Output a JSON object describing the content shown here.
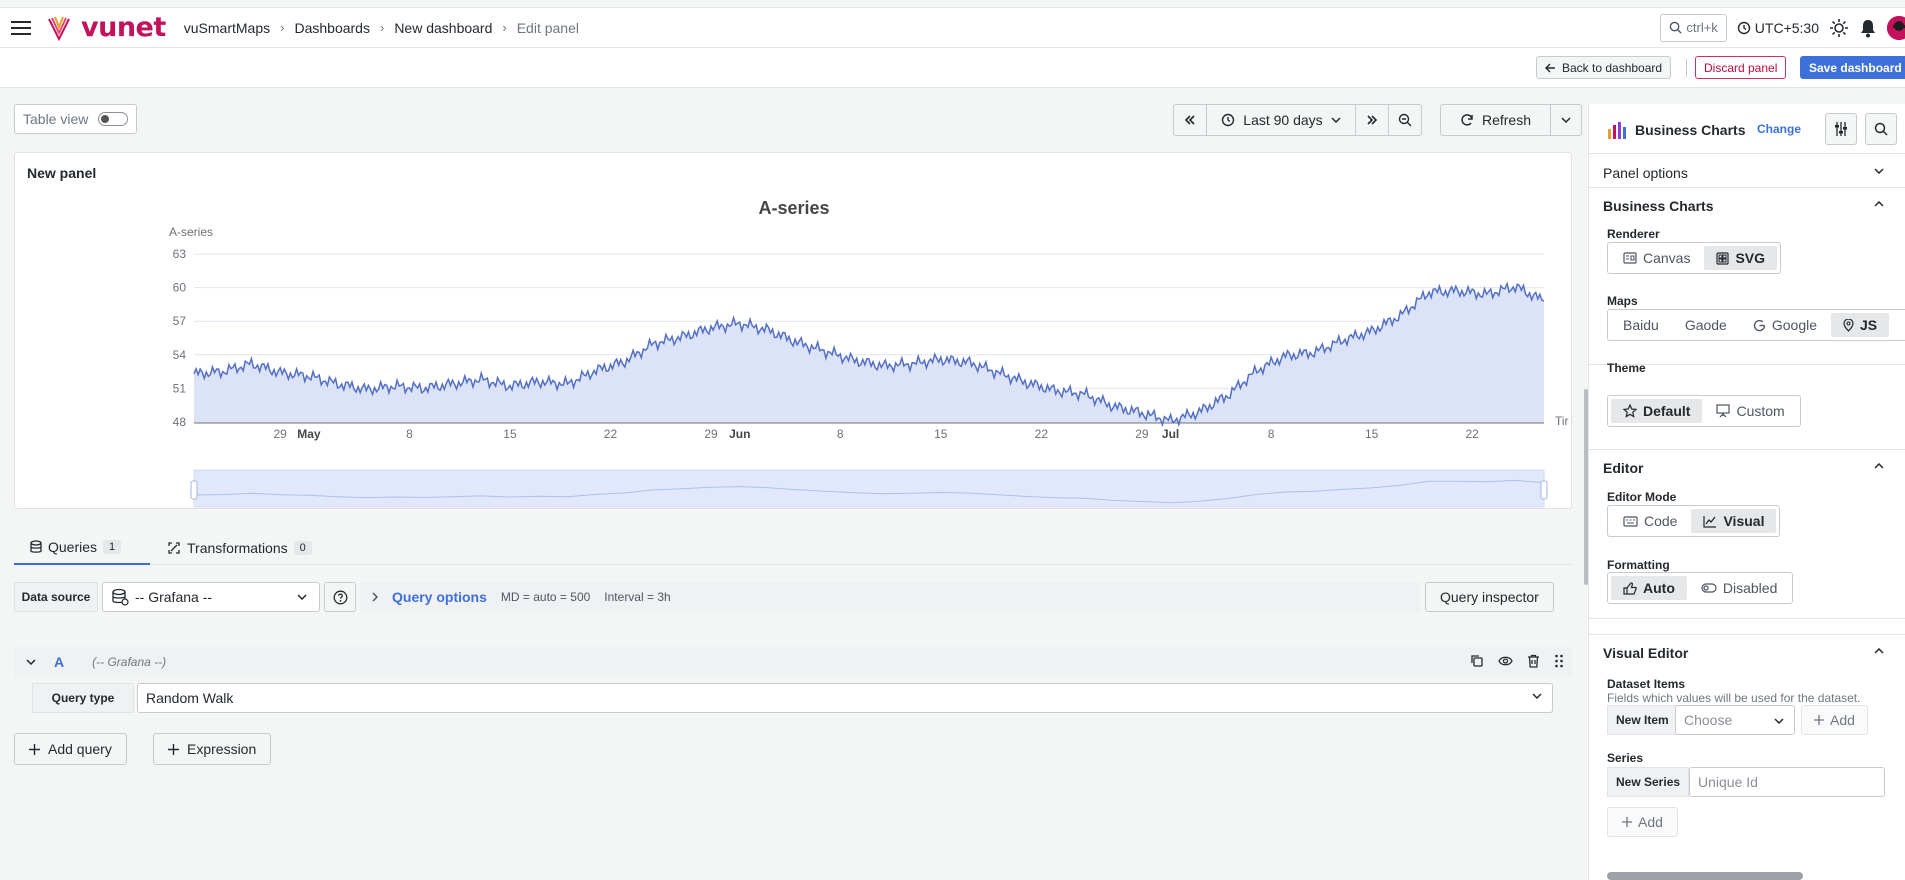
{
  "app": {
    "logo": "vunet"
  },
  "breadcrumbs": [
    "vuSmartMaps",
    "Dashboards",
    "New dashboard",
    "Edit panel"
  ],
  "topbar": {
    "search_label": "ctrl+k",
    "timezone": "UTC+5:30"
  },
  "actions": {
    "back": "Back to dashboard",
    "discard": "Discard panel",
    "save": "Save dashboard"
  },
  "toolbar": {
    "table_view": "Table view",
    "time_range": "Last 90 days",
    "refresh": "Refresh"
  },
  "panel": {
    "title": "New panel"
  },
  "chart_data": {
    "type": "area",
    "title": "A-series",
    "ylabel": "A-series",
    "xlabel": "Tir",
    "ylim": [
      48,
      63
    ],
    "yticks": [
      48,
      51,
      54,
      57,
      60,
      63
    ],
    "xlim": [
      0,
      94
    ],
    "xticks": [
      {
        "x": 6,
        "label": "29"
      },
      {
        "x": 8,
        "label": "May",
        "bold": true
      },
      {
        "x": 15,
        "label": "8"
      },
      {
        "x": 22,
        "label": "15"
      },
      {
        "x": 29,
        "label": "22"
      },
      {
        "x": 36,
        "label": "29"
      },
      {
        "x": 38,
        "label": "Jun",
        "bold": true
      },
      {
        "x": 45,
        "label": "8"
      },
      {
        "x": 52,
        "label": "15"
      },
      {
        "x": 59,
        "label": "22"
      },
      {
        "x": 66,
        "label": "29"
      },
      {
        "x": 68,
        "label": "Jul",
        "bold": true
      },
      {
        "x": 75,
        "label": "8"
      },
      {
        "x": 82,
        "label": "15"
      },
      {
        "x": 89,
        "label": "22"
      }
    ],
    "series": [
      {
        "x": [
          0,
          2,
          4,
          6,
          8,
          10,
          12,
          14,
          16,
          18,
          20,
          22,
          24,
          26,
          28,
          30,
          32,
          34,
          36,
          38,
          40,
          42,
          44,
          46,
          48,
          50,
          52,
          54,
          56,
          58,
          60,
          62,
          64,
          66,
          68,
          70,
          72,
          74,
          76,
          78,
          80,
          82,
          84,
          86,
          88,
          90,
          92,
          94
        ],
        "values": [
          52.3,
          52.5,
          53.2,
          52.4,
          52.1,
          51.4,
          50.9,
          51.2,
          51.0,
          51.4,
          51.8,
          51.2,
          51.6,
          51.4,
          52.6,
          53.4,
          55.0,
          55.6,
          56.4,
          56.8,
          56.2,
          55.1,
          54.3,
          53.5,
          53.0,
          53.2,
          53.6,
          53.3,
          52.4,
          51.5,
          50.8,
          50.5,
          49.4,
          48.8,
          48.1,
          48.9,
          50.4,
          52.6,
          53.9,
          54.2,
          55.3,
          56.1,
          57.5,
          59.6,
          59.7,
          59.4,
          60.1,
          58.8
        ]
      }
    ],
    "color": "#5470c6",
    "fill": "#dde3f6"
  },
  "tabs": [
    {
      "label": "Queries",
      "count": "1"
    },
    {
      "label": "Transformations",
      "count": "0"
    }
  ],
  "query_row": {
    "datasource_label": "Data source",
    "datasource_value": "-- Grafana --",
    "options_label": "Query options",
    "md": "MD = auto = 500",
    "interval": "Interval = 3h",
    "inspector": "Query inspector"
  },
  "query": {
    "ref_id": "A",
    "datasource": "(-- Grafana --)",
    "type_label": "Query type",
    "type_value": "Random Walk"
  },
  "buttons": {
    "add_query": "Add query",
    "expression": "Expression"
  },
  "right_pane": {
    "plugin": "Business Charts",
    "change": "Change",
    "panel_options": "Panel options",
    "section_business": "Business Charts",
    "renderer_label": "Renderer",
    "renderer_opts": [
      "Canvas",
      "SVG"
    ],
    "maps_label": "Maps",
    "maps_opts": [
      "Baidu",
      "Gaode",
      "Google",
      "JS"
    ],
    "theme_label": "Theme",
    "theme_opts": [
      "Default",
      "Custom"
    ],
    "section_editor": "Editor",
    "editor_mode_label": "Editor Mode",
    "editor_mode_opts": [
      "Code",
      "Visual"
    ],
    "formatting_label": "Formatting",
    "formatting_opts": [
      "Auto",
      "Disabled"
    ],
    "section_visual": "Visual Editor",
    "dataset_label": "Dataset Items",
    "dataset_desc": "Fields which values will be used for the dataset.",
    "new_item": "New Item",
    "choose": "Choose",
    "add": "Add",
    "series_label": "Series",
    "new_series": "New Series",
    "unique_id": "Unique Id",
    "add_series": "Add"
  }
}
